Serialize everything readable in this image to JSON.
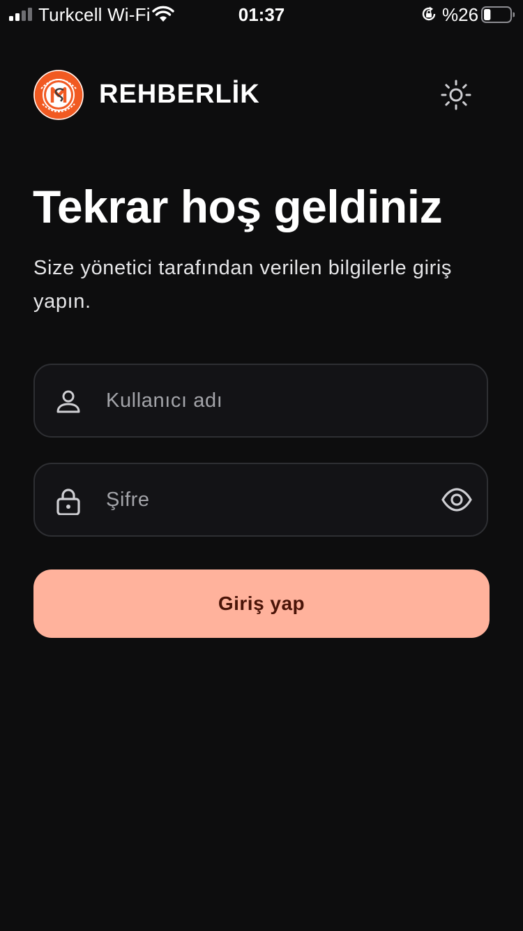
{
  "status_bar": {
    "carrier": "Turkcell Wi-Fi",
    "time": "01:37",
    "battery_percent": "%26",
    "battery_level": 0.26,
    "icons": [
      "signal-icon",
      "wifi-icon",
      "rotation-lock-icon",
      "battery-icon"
    ]
  },
  "header": {
    "logo_icon": "reyhanli-sah-mat-logo",
    "brand": "REHBERLİK",
    "theme_toggle_icon": "sun-icon"
  },
  "main": {
    "title": "Tekrar hoş geldiniz",
    "subtitle": "Size yönetici tarafından verilen bilgilerle giriş yapın."
  },
  "form": {
    "username": {
      "placeholder": "Kullanıcı adı",
      "value": "",
      "icon": "user-icon"
    },
    "password": {
      "placeholder": "Şifre",
      "value": "",
      "icon": "lock-icon",
      "toggle_icon": "eye-icon"
    },
    "submit_label": "Giriş yap"
  },
  "colors": {
    "background": "#0d0d0e",
    "field_background": "#131316",
    "field_border": "#2e2f33",
    "button_background": "#ffb29c",
    "button_text": "#4a1408",
    "logo_accent": "#f15a22"
  }
}
